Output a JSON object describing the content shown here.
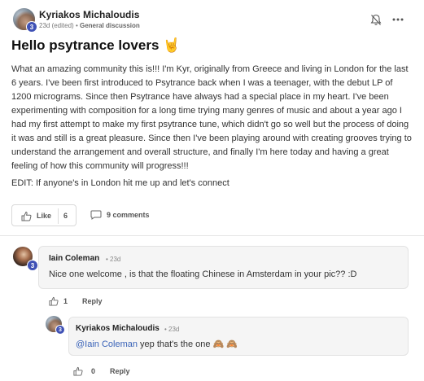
{
  "post": {
    "author": "Kyriakos Michaloudis",
    "author_level": "3",
    "age": "23d (edited)",
    "separator": "•",
    "category": "General discussion",
    "title": "Hello psytrance lovers",
    "title_emoji": "🤘",
    "body": "What an amazing community this is!!! I'm Kyr, originally from Greece and living in London for the last 6 years. I've been first introduced to Psytrance back when I was a teenager, with the debut LP of 1200 micrograms. Since then Psytrance have always had a special place in my heart. I've been experimenting with composition for a long time trying many genres of music and about a year ago I had my first attempt to make my first psytrance tune, which didn't go so well but the process of doing it was and still is a great pleasure. Since then I've been playing around with creating grooves trying to understand the arrangement and overall structure, and finally I'm here today and having a great feeling of how this community will progress!!!",
    "edit_note": "EDIT: If anyone's in London hit me up and let's connect",
    "like_label": "Like",
    "like_count": "6",
    "comments_label": "9 comments"
  },
  "header_icons": [
    "bell-off-icon",
    "more-options-icon"
  ],
  "comments": [
    {
      "author": "Iain Coleman",
      "level": "3",
      "time": "• 23d",
      "text": "Nice one welcome , is that the floating Chinese in Amsterdam in your pic?? :D",
      "likes": "1",
      "reply_label": "Reply"
    },
    {
      "author": "Kyriakos Michaloudis",
      "level": "3",
      "time": "• 23d",
      "mention": "@Iain Coleman",
      "text": " yep that's the one",
      "emojis": "🙈 🙈",
      "likes": "0",
      "reply_label": "Reply"
    }
  ],
  "colors": {
    "level_badge": "#3f51b5",
    "mention": "#3a63b8",
    "bubble_bg": "#f5f5f5"
  }
}
